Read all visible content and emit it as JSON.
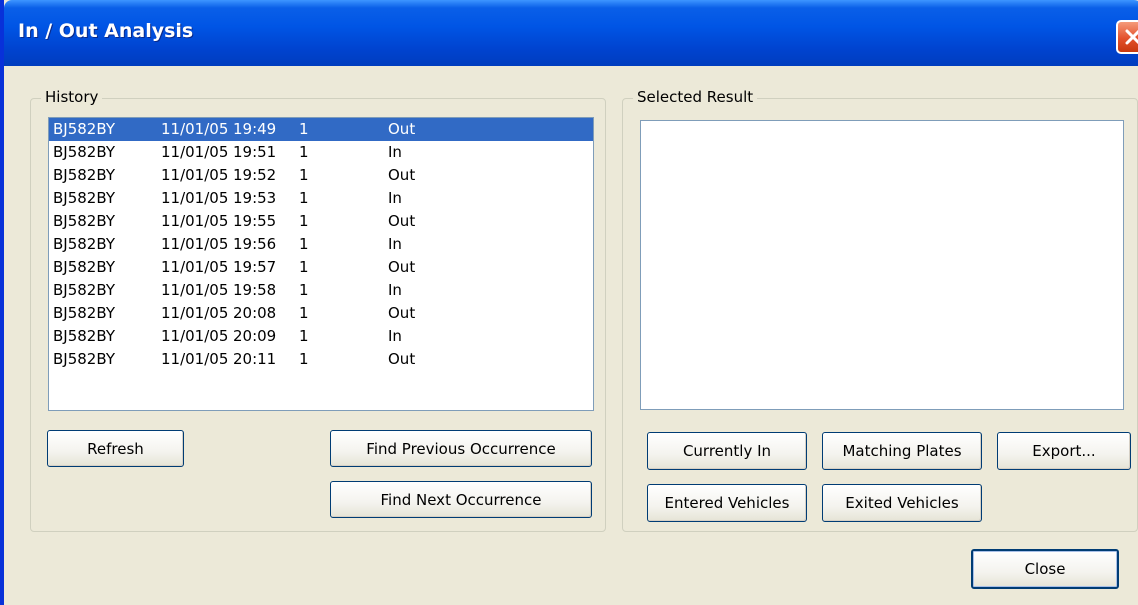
{
  "window": {
    "title": "In / Out Analysis"
  },
  "history": {
    "label": "History",
    "rows": [
      {
        "plate": "BJ582BY",
        "date": "11/01/05",
        "time": "19:49",
        "count": "1",
        "direction": "Out"
      },
      {
        "plate": "BJ582BY",
        "date": "11/01/05",
        "time": "19:51",
        "count": "1",
        "direction": "In"
      },
      {
        "plate": "BJ582BY",
        "date": "11/01/05",
        "time": "19:52",
        "count": "1",
        "direction": "Out"
      },
      {
        "plate": "BJ582BY",
        "date": "11/01/05",
        "time": "19:53",
        "count": "1",
        "direction": "In"
      },
      {
        "plate": "BJ582BY",
        "date": "11/01/05",
        "time": "19:55",
        "count": "1",
        "direction": "Out"
      },
      {
        "plate": "BJ582BY",
        "date": "11/01/05",
        "time": "19:56",
        "count": "1",
        "direction": "In"
      },
      {
        "plate": "BJ582BY",
        "date": "11/01/05",
        "time": "19:57",
        "count": "1",
        "direction": "Out"
      },
      {
        "plate": "BJ582BY",
        "date": "11/01/05",
        "time": "19:58",
        "count": "1",
        "direction": "In"
      },
      {
        "plate": "BJ582BY",
        "date": "11/01/05",
        "time": "20:08",
        "count": "1",
        "direction": "Out"
      },
      {
        "plate": "BJ582BY",
        "date": "11/01/05",
        "time": "20:09",
        "count": "1",
        "direction": "In"
      },
      {
        "plate": "BJ582BY",
        "date": "11/01/05",
        "time": "20:11",
        "count": "1",
        "direction": "Out"
      }
    ],
    "buttons": {
      "refresh": "Refresh",
      "find_previous": "Find Previous Occurrence",
      "find_next": "Find Next Occurrence"
    }
  },
  "selected_result": {
    "label": "Selected Result",
    "buttons": {
      "currently_in": "Currently In",
      "matching_plates": "Matching Plates",
      "export": "Export...",
      "entered_vehicles": "Entered Vehicles",
      "exited_vehicles": "Exited Vehicles"
    }
  },
  "footer": {
    "close": "Close"
  },
  "colors": {
    "titlebar": "#0055e5",
    "selection": "#316ac5",
    "dialog_bg": "#ece9d8"
  },
  "icons": {
    "close": "close-x-icon"
  }
}
